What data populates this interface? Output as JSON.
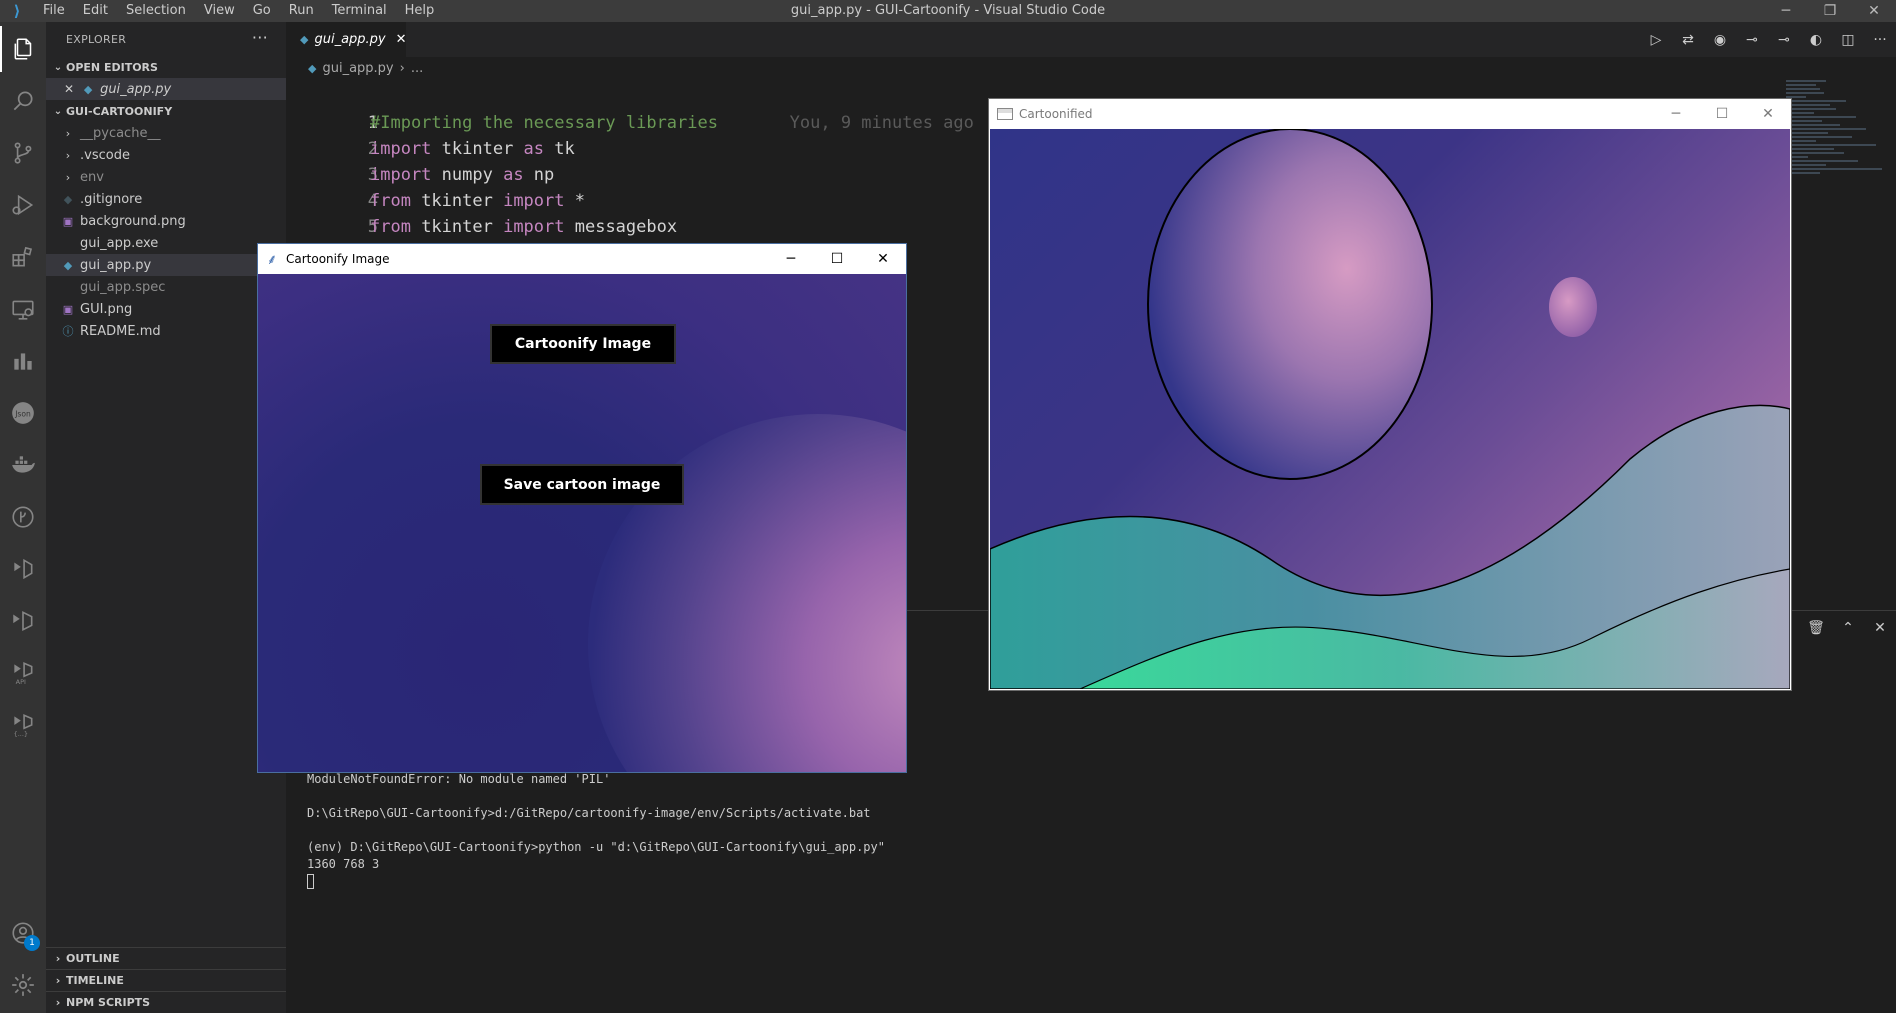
{
  "window": {
    "title": "gui_app.py - GUI-Cartoonify - Visual Studio Code",
    "controls": [
      "─",
      "❐",
      "✕"
    ]
  },
  "menu": [
    "File",
    "Edit",
    "Selection",
    "View",
    "Go",
    "Run",
    "Terminal",
    "Help"
  ],
  "activity_bar": {
    "items": [
      "explorer-icon",
      "search-icon",
      "source-control-icon",
      "run-debug-icon",
      "extensions-icon",
      "remote-explorer-icon",
      "chart-icon",
      "json-icon",
      "docker-icon",
      "git-graph-icon",
      "test-icon",
      "deploy-icon",
      "api-icon",
      "settings-sync-icon"
    ],
    "account_badge": "1"
  },
  "sidebar": {
    "header": "EXPLORER",
    "more": "···",
    "open_editors": {
      "label": "OPEN EDITORS",
      "items": [
        {
          "name": "gui_app.py"
        }
      ]
    },
    "project": {
      "label": "GUI-CARTOONIFY",
      "items": [
        {
          "name": "__pycache__",
          "type": "folder"
        },
        {
          "name": ".vscode",
          "type": "folder"
        },
        {
          "name": "env",
          "type": "folder"
        },
        {
          "name": ".gitignore",
          "type": "file"
        },
        {
          "name": "background.png",
          "type": "image"
        },
        {
          "name": "gui_app.exe",
          "type": "file"
        },
        {
          "name": "gui_app.py",
          "type": "python"
        },
        {
          "name": "gui_app.spec",
          "type": "file"
        },
        {
          "name": "GUI.png",
          "type": "image"
        },
        {
          "name": "README.md",
          "type": "info"
        }
      ]
    },
    "bottom_sections": [
      "OUTLINE",
      "TIMELINE",
      "NPM SCRIPTS"
    ]
  },
  "editor": {
    "tab": "gui_app.py",
    "breadcrumb": [
      "gui_app.py",
      "..."
    ],
    "lines": [
      {
        "n": "1",
        "parts": [
          [
            "cm",
            "#Importing the necessary libraries"
          ],
          [
            "blame",
            "       You, 9 minutes ago"
          ]
        ]
      },
      {
        "n": "2",
        "parts": [
          [
            "kw",
            "import"
          ],
          [
            "tx",
            " tkinter "
          ],
          [
            "kw",
            "as"
          ],
          [
            "tx",
            " tk"
          ]
        ]
      },
      {
        "n": "3",
        "parts": [
          [
            "kw",
            "import"
          ],
          [
            "tx",
            " numpy "
          ],
          [
            "kw",
            "as"
          ],
          [
            "tx",
            " np"
          ]
        ]
      },
      {
        "n": "4",
        "parts": [
          [
            "kw",
            "from"
          ],
          [
            "tx",
            " tkinter "
          ],
          [
            "kw",
            "import"
          ],
          [
            "tx",
            " *"
          ]
        ]
      },
      {
        "n": "5",
        "parts": [
          [
            "kw",
            "from"
          ],
          [
            "tx",
            " tkinter "
          ],
          [
            "kw",
            "import"
          ],
          [
            "tx",
            " messagebox"
          ]
        ]
      }
    ]
  },
  "terminal": {
    "lines": [
      "ModuleNotFoundError: No module named 'PIL'",
      "",
      "D:\\GitRepo\\GUI-Cartoonify>d:/GitRepo/cartoonify-image/env/Scripts/activate.bat",
      "",
      "(env) D:\\GitRepo\\GUI-Cartoonify>python -u \"d:\\GitRepo\\GUI-Cartoonify\\gui_app.py\"",
      "1360 768 3"
    ]
  },
  "tk_window": {
    "title": "Cartoonify Image",
    "button_cartoonify": "Cartoonify Image",
    "button_save": "Save cartoon image"
  },
  "cartoon_window": {
    "title": "Cartoonified"
  },
  "colors": {
    "editor_bg": "#1e1e1e",
    "sidebar_bg": "#252526",
    "activity_bg": "#333333",
    "keyword": "#c586c0",
    "comment": "#6a9955"
  }
}
